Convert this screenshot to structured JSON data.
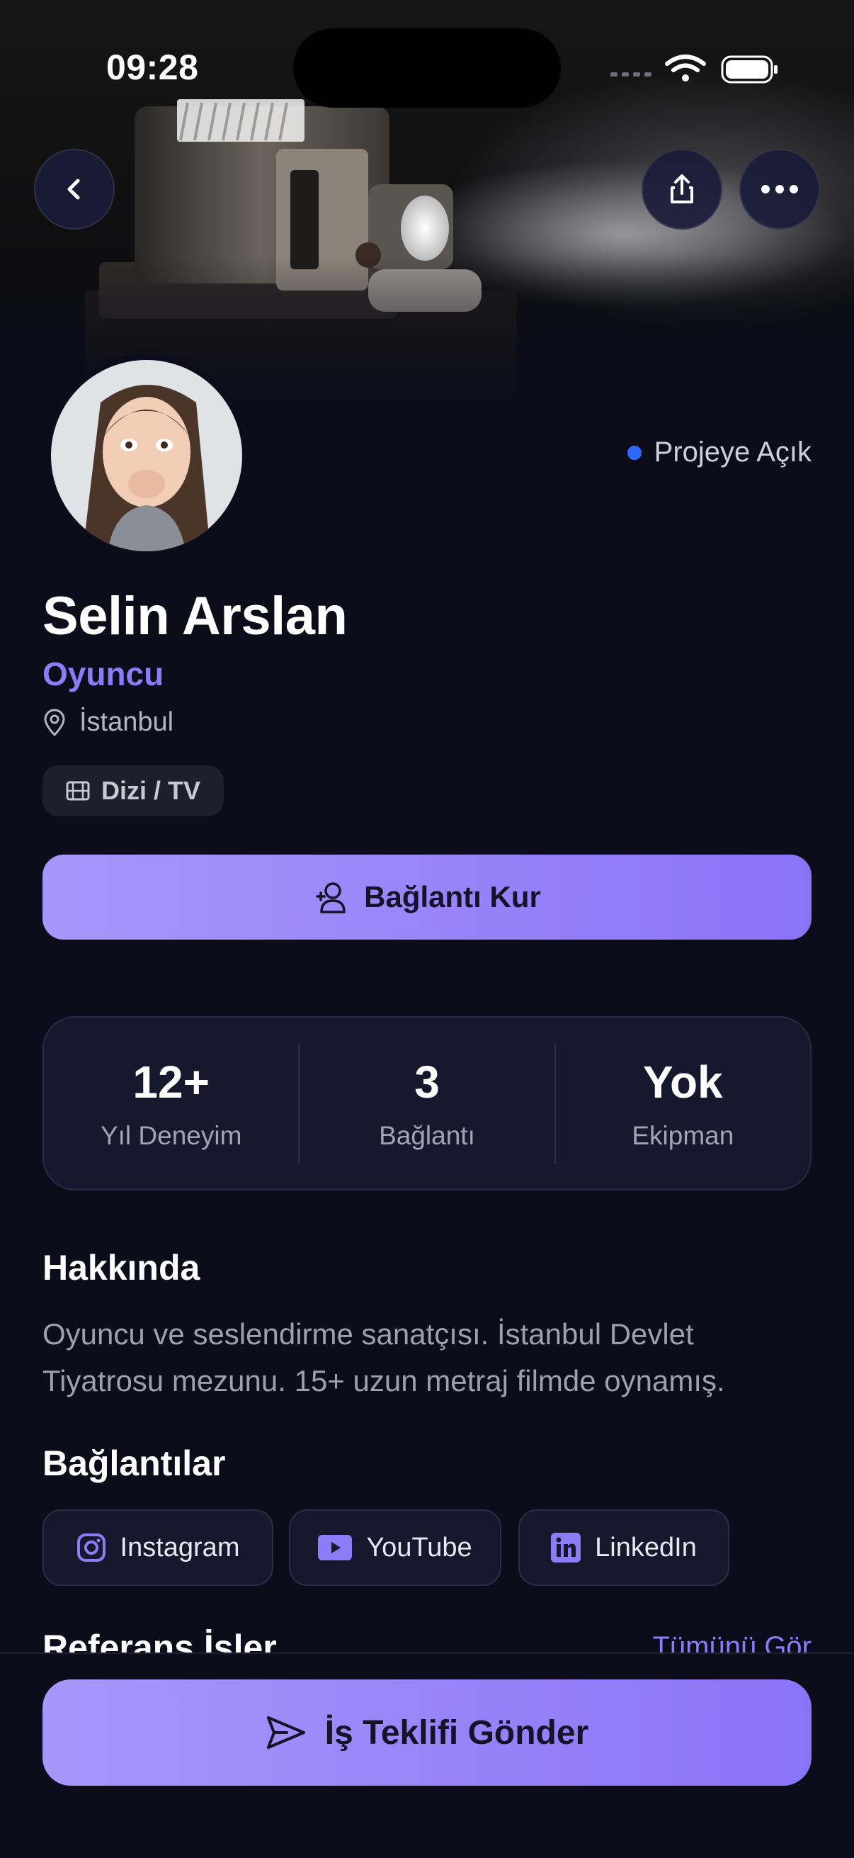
{
  "status_bar": {
    "time": "09:28"
  },
  "header": {
    "back_icon": "chevron-left-icon",
    "share_icon": "share-icon",
    "more_icon": "more-horizontal-icon"
  },
  "profile": {
    "availability": "Projeye Açık",
    "availability_color": "#2f6bff",
    "name": "Selin Arslan",
    "role": "Oyuncu",
    "location": "İstanbul",
    "category_tag": "Dizi / TV",
    "connect_label": "Bağlantı Kur"
  },
  "stats": [
    {
      "value": "12+",
      "label": "Yıl Deneyim"
    },
    {
      "value": "3",
      "label": "Bağlantı"
    },
    {
      "value": "Yok",
      "label": "Ekipman"
    }
  ],
  "about": {
    "title": "Hakkında",
    "text": "Oyuncu ve seslendirme sanatçısı. İstanbul Devlet Tiyatrosu mezunu. 15+ uzun metraj filmde oynamış."
  },
  "links": {
    "title": "Bağlantılar",
    "items": [
      {
        "label": "Instagram",
        "icon": "instagram-icon"
      },
      {
        "label": "YouTube",
        "icon": "youtube-icon"
      },
      {
        "label": "LinkedIn",
        "icon": "linkedin-icon"
      }
    ]
  },
  "references": {
    "title": "Referans İşler",
    "see_all": "Tümünü Gör"
  },
  "cta": {
    "label": "İş Teklifi Gönder"
  },
  "colors": {
    "accent": "#8e7bf6",
    "button_start": "#a797fa",
    "button_end": "#8a73f7",
    "background": "#0c0c1a"
  }
}
